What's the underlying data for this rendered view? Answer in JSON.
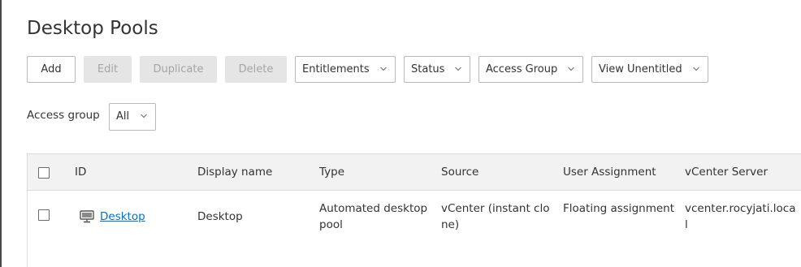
{
  "page": {
    "title": "Desktop Pools"
  },
  "toolbar": {
    "add_label": "Add",
    "edit_label": "Edit",
    "duplicate_label": "Duplicate",
    "delete_label": "Delete",
    "entitlements_label": "Entitlements",
    "status_label": "Status",
    "access_group_label": "Access Group",
    "view_unentitled_label": "View Unentitled"
  },
  "filter": {
    "label": "Access group",
    "selected": "All"
  },
  "table": {
    "columns": [
      "ID",
      "Display name",
      "Type",
      "Source",
      "User Assignment",
      "vCenter Server"
    ],
    "rows": [
      {
        "id": "Desktop",
        "display_name": "Desktop",
        "type": "Automated desktop pool",
        "source": "vCenter (instant clone)",
        "user_assignment": "Floating assignment",
        "vcenter_server": "vcenter.rocyjati.local",
        "icon": "monitor-icon"
      }
    ]
  },
  "colors": {
    "link": "#0072c6",
    "header_bg": "#f2f2f2",
    "disabled_bg": "#e5e5e5"
  }
}
